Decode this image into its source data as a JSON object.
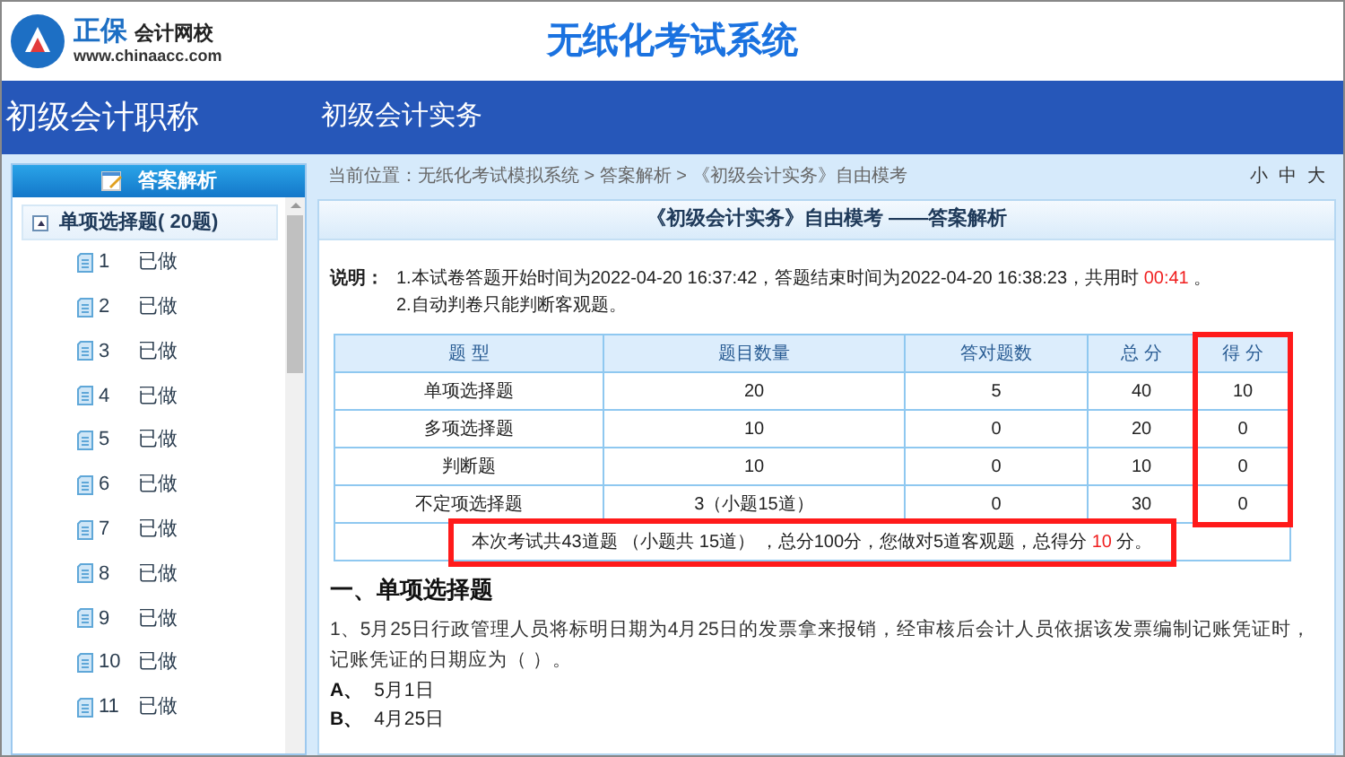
{
  "header": {
    "logo_name": "正保",
    "logo_sub": "会计网校",
    "logo_url": "www.chinaacc.com",
    "title": "无纸化考试系统"
  },
  "banner": {
    "level": "初级会计职称",
    "subject": "初级会计实务"
  },
  "sidebar": {
    "title": "答案解析",
    "group": {
      "label": "单项选择题( 20题)",
      "expanded": true,
      "items": [
        {
          "number": "1",
          "status": "已做"
        },
        {
          "number": "2",
          "status": "已做"
        },
        {
          "number": "3",
          "status": "已做"
        },
        {
          "number": "4",
          "status": "已做"
        },
        {
          "number": "5",
          "status": "已做"
        },
        {
          "number": "6",
          "status": "已做"
        },
        {
          "number": "7",
          "status": "已做"
        },
        {
          "number": "8",
          "status": "已做"
        },
        {
          "number": "9",
          "status": "已做"
        },
        {
          "number": "10",
          "status": "已做"
        },
        {
          "number": "11",
          "status": "已做"
        }
      ]
    }
  },
  "breadcrumb": "当前位置：无纸化考试模拟系统 > 答案解析 > 《初级会计实务》自由模考",
  "font_sizes": [
    "小",
    "中",
    "大"
  ],
  "panel_title": "《初级会计实务》自由模考 ——答案解析",
  "notes": {
    "label": "说明：",
    "line1": "1.本试卷答题开始时间为2022-04-20 16:37:42，答题结束时间为2022-04-20 16:38:23，共用时 ",
    "duration": "00:41",
    "line1_end": " 。",
    "line2": "2.自动判卷只能判断客观题。"
  },
  "table": {
    "columns": [
      {
        "title": "题 型",
        "highlighted": false
      },
      {
        "title": "题目数量",
        "highlighted": false
      },
      {
        "title": "答对题数",
        "highlighted": false
      },
      {
        "title": "总 分",
        "highlighted": false
      },
      {
        "title": "得 分",
        "highlighted": true
      }
    ],
    "rows": [
      [
        "单项选择题",
        "20",
        "5",
        "40",
        "10"
      ],
      [
        "多项选择题",
        "10",
        "0",
        "20",
        "0"
      ],
      [
        "判断题",
        "10",
        "0",
        "10",
        "0"
      ],
      [
        "不定项选择题",
        "3（小题15道）",
        "0",
        "30",
        "0"
      ]
    ],
    "summary": {
      "text": "本次考试共43道题 （小题共 15道） ，总分100分，您做对5道客观题，总得分 ",
      "score": "10",
      "end": " 分。",
      "highlighted": true
    }
  },
  "section": "一、单项选择题",
  "question": {
    "text": "1、5月25日行政管理人员将标明日期为4月25日的发票拿来报销，经审核后会计人员依据该发票编制记账凭证时，记账凭证的日期应为（    ）。",
    "options": [
      {
        "letter": "A、",
        "text": "5月1日"
      },
      {
        "letter": "B、",
        "text": "4月25日"
      }
    ]
  }
}
